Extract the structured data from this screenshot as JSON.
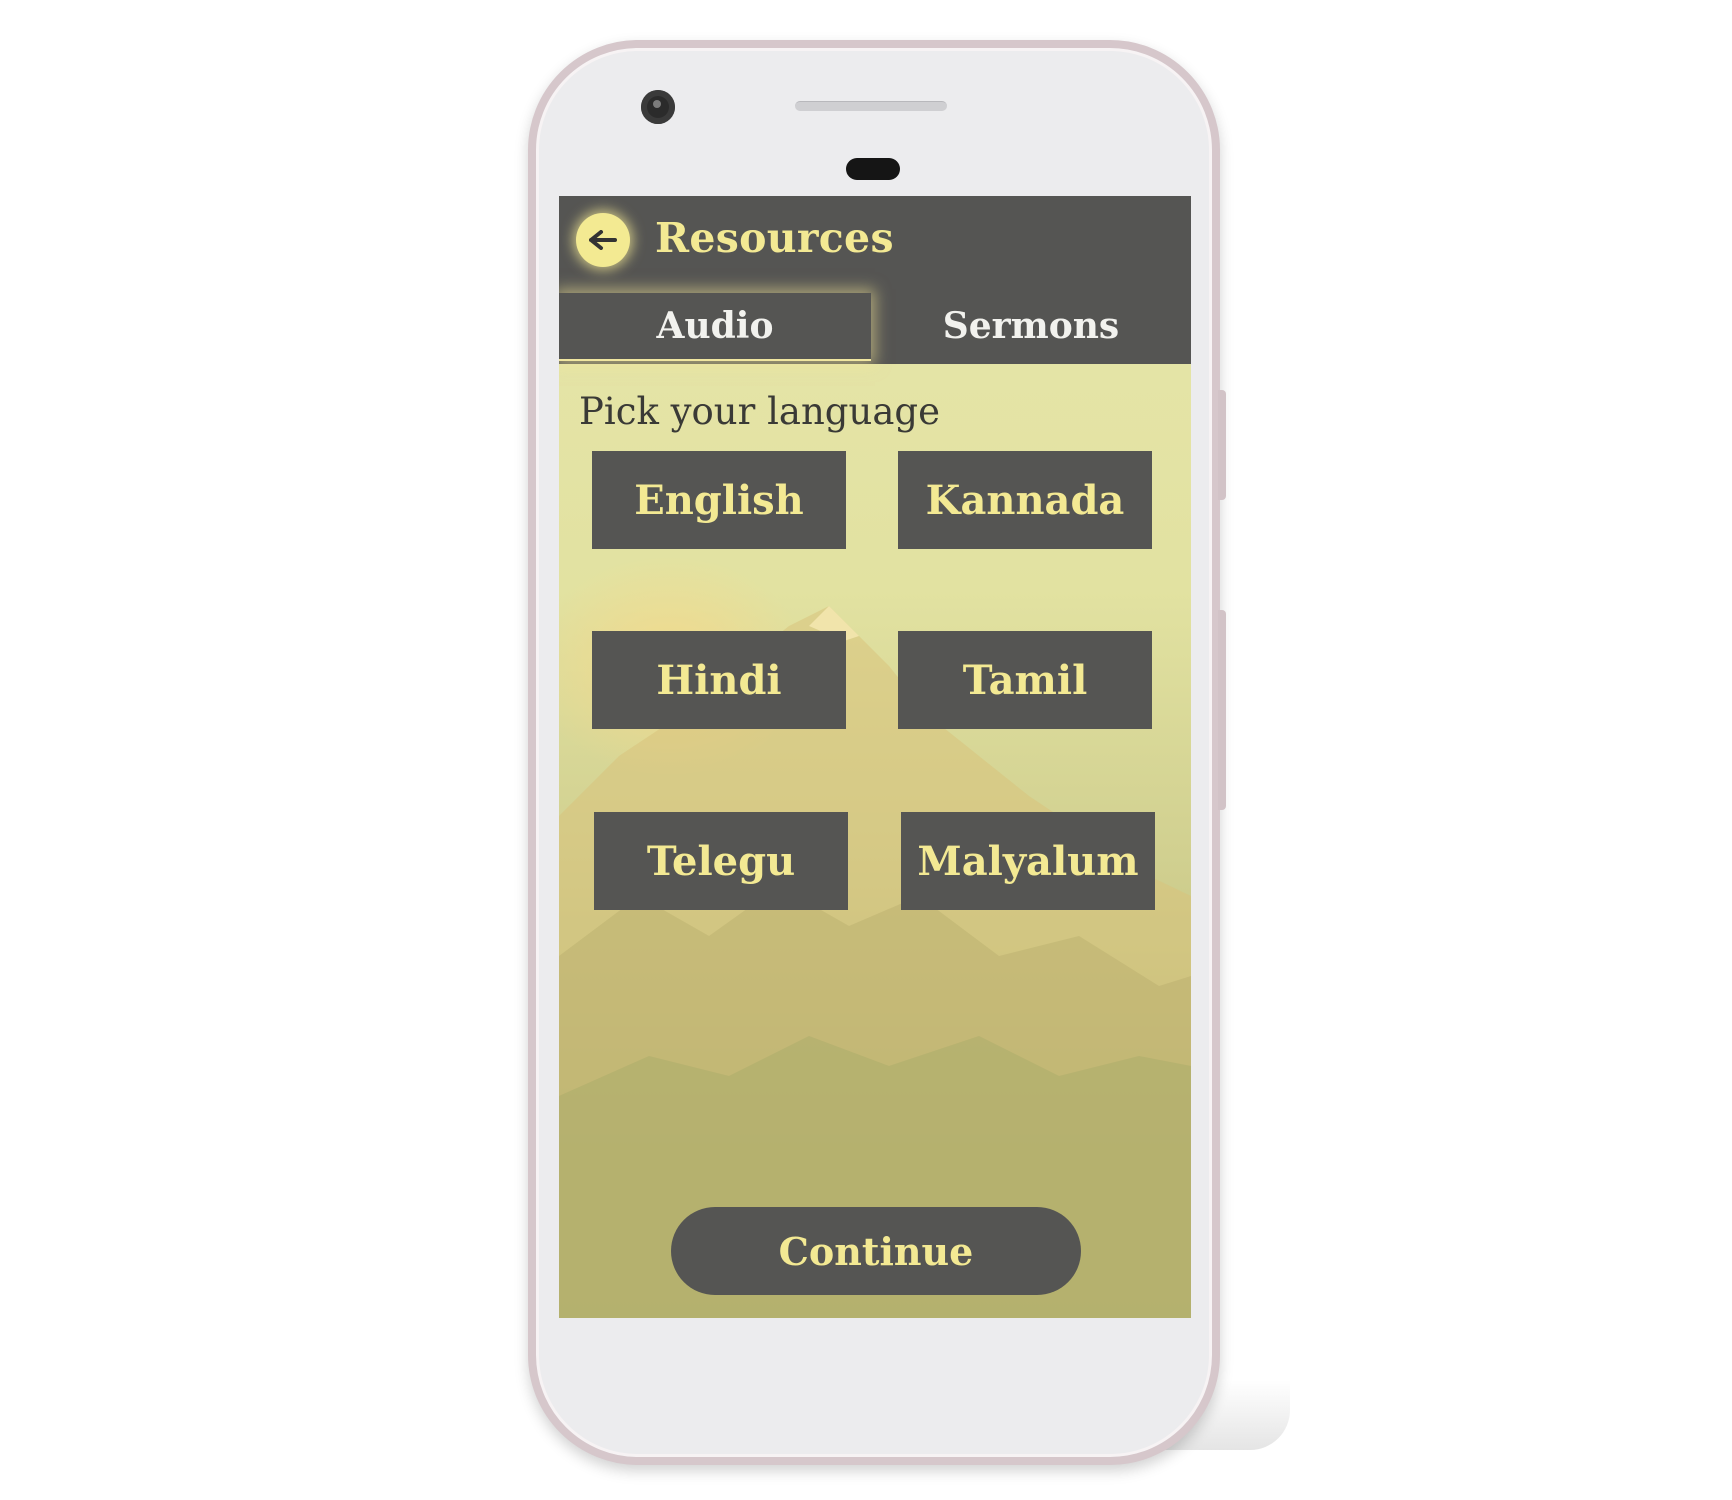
{
  "header": {
    "title": "Resources",
    "back_icon": "arrow-left-icon"
  },
  "tabs": [
    {
      "label": "Audio",
      "selected": true
    },
    {
      "label": "Sermons",
      "selected": false
    }
  ],
  "main": {
    "prompt": "Pick your language",
    "languages": [
      "English",
      "Kannada",
      "Hindi",
      "Tamil",
      "Telegu",
      "Malyalum"
    ],
    "continue_label": "Continue"
  },
  "colors": {
    "bar": "#555553",
    "accent": "#f3e993",
    "screen_bg": "#e2e2a1"
  }
}
